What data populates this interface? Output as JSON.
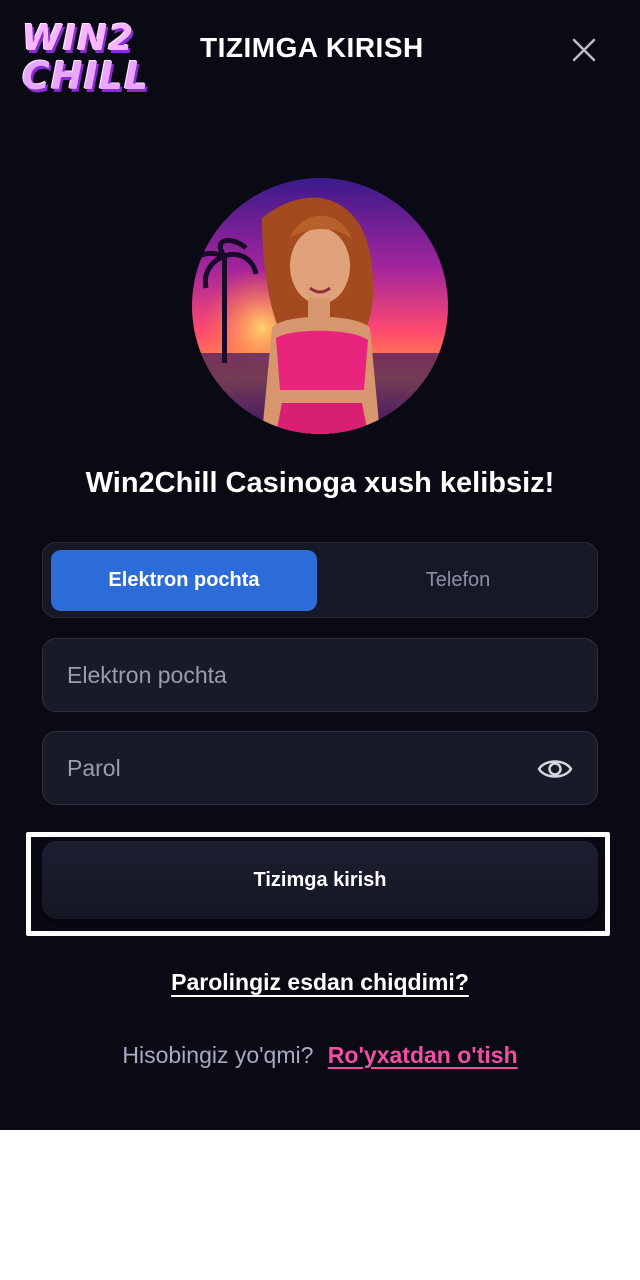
{
  "header": {
    "logo_line1": "WIN2",
    "logo_line2": "CHILL",
    "title": "TIZIMGA KIRISH",
    "close_icon": "close-icon"
  },
  "welcome": "Win2Chill Casinoga xush kelibsiz!",
  "tabs": [
    {
      "label": "Elektron pochta",
      "active": true
    },
    {
      "label": "Telefon",
      "active": false
    }
  ],
  "form": {
    "email_placeholder": "Elektron pochta",
    "email_value": "",
    "password_placeholder": "Parol",
    "password_value": "",
    "eye_icon": "eye-icon",
    "submit_label": "Tizimga kirish"
  },
  "links": {
    "forgot": "Parolingiz esdan chiqdimi?",
    "no_account": "Hisobingiz yo'qmi?",
    "register": "Ro'yxatdan o'tish"
  },
  "colors": {
    "background": "#0a0a14",
    "active_tab": "#2b6cd8",
    "register_link": "#f14fa5"
  }
}
